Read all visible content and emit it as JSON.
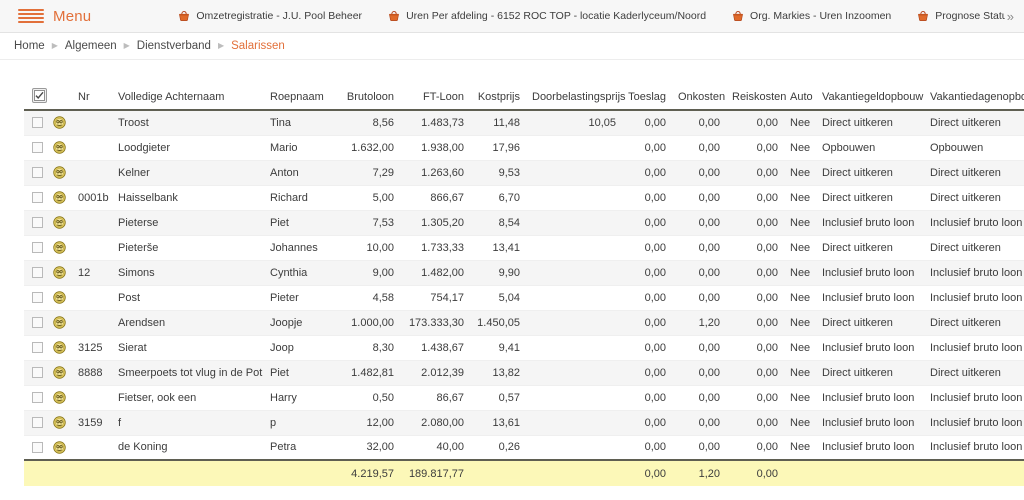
{
  "topbar": {
    "menu_label": "Menu",
    "menu_icon": "hamburger-icon",
    "overflow_icon": "double-chevron-right-icon",
    "tabs": [
      {
        "icon": "basket-icon",
        "label": "Omzetregistratie - J.U. Pool Beheer"
      },
      {
        "icon": "basket-icon",
        "label": "Uren Per afdeling - 6152 ROC TOP - locatie Kaderlyceum/Noord"
      },
      {
        "icon": "basket-icon",
        "label": "Org. Markies - Uren Inzoomen"
      },
      {
        "icon": "basket-icon",
        "label": "Prognose Status - J.U. Pool Beheer BV"
      }
    ]
  },
  "breadcrumb": {
    "separator": "▶",
    "items": [
      {
        "label": "Home",
        "current": false
      },
      {
        "label": "Algemeen",
        "current": false
      },
      {
        "label": "Dienstverband",
        "current": false
      },
      {
        "label": "Salarissen",
        "current": true
      }
    ]
  },
  "table": {
    "select_all_icon": "select-all-icon",
    "row_icon": "employee-coin-icon",
    "columns": [
      {
        "key": "check",
        "label": ""
      },
      {
        "key": "icon",
        "label": ""
      },
      {
        "key": "nr",
        "label": "Nr"
      },
      {
        "key": "ach",
        "label": "Volledige Achternaam"
      },
      {
        "key": "roep",
        "label": "Roepnaam"
      },
      {
        "key": "bruto",
        "label": "Brutoloon"
      },
      {
        "key": "ft",
        "label": "FT-Loon"
      },
      {
        "key": "kost",
        "label": "Kostprijs"
      },
      {
        "key": "door",
        "label": "Doorbelastingsprijs"
      },
      {
        "key": "toes",
        "label": "Toeslag"
      },
      {
        "key": "onk",
        "label": "Onkosten"
      },
      {
        "key": "reis",
        "label": "Reiskosten"
      },
      {
        "key": "auto",
        "label": "Auto"
      },
      {
        "key": "vgo",
        "label": "Vakantiegeldopbouw"
      },
      {
        "key": "vdo",
        "label": "Vakantiedagenopbouw"
      }
    ],
    "rows": [
      {
        "nr": "",
        "ach": "Troost",
        "roep": "Tina",
        "bruto": "8,56",
        "ft": "1.483,73",
        "kost": "11,48",
        "door": "10,05",
        "toes": "0,00",
        "onk": "0,00",
        "reis": "0,00",
        "auto": "Nee",
        "vgo": "Direct uitkeren",
        "vdo": "Direct uitkeren"
      },
      {
        "nr": "",
        "ach": "Loodgieter",
        "roep": "Mario",
        "bruto": "1.632,00",
        "ft": "1.938,00",
        "kost": "17,96",
        "door": "",
        "toes": "0,00",
        "onk": "0,00",
        "reis": "0,00",
        "auto": "Nee",
        "vgo": "Opbouwen",
        "vdo": "Opbouwen"
      },
      {
        "nr": "",
        "ach": "Kelner",
        "roep": "Anton",
        "bruto": "7,29",
        "ft": "1.263,60",
        "kost": "9,53",
        "door": "",
        "toes": "0,00",
        "onk": "0,00",
        "reis": "0,00",
        "auto": "Nee",
        "vgo": "Direct uitkeren",
        "vdo": "Direct uitkeren"
      },
      {
        "nr": "0001b",
        "ach": "Haisselbank",
        "roep": "Richard",
        "bruto": "5,00",
        "ft": "866,67",
        "kost": "6,70",
        "door": "",
        "toes": "0,00",
        "onk": "0,00",
        "reis": "0,00",
        "auto": "Nee",
        "vgo": "Direct uitkeren",
        "vdo": "Direct uitkeren"
      },
      {
        "nr": "",
        "ach": "Pieterse",
        "roep": "Piet",
        "bruto": "7,53",
        "ft": "1.305,20",
        "kost": "8,54",
        "door": "",
        "toes": "0,00",
        "onk": "0,00",
        "reis": "0,00",
        "auto": "Nee",
        "vgo": "Inclusief bruto loon",
        "vdo": "Inclusief bruto loon"
      },
      {
        "nr": "",
        "ach": "Pieterše",
        "roep": "Johannes",
        "bruto": "10,00",
        "ft": "1.733,33",
        "kost": "13,41",
        "door": "",
        "toes": "0,00",
        "onk": "0,00",
        "reis": "0,00",
        "auto": "Nee",
        "vgo": "Direct uitkeren",
        "vdo": "Direct uitkeren"
      },
      {
        "nr": "12",
        "ach": "Simons",
        "roep": "Cynthia",
        "bruto": "9,00",
        "ft": "1.482,00",
        "kost": "9,90",
        "door": "",
        "toes": "0,00",
        "onk": "0,00",
        "reis": "0,00",
        "auto": "Nee",
        "vgo": "Inclusief bruto loon",
        "vdo": "Inclusief bruto loon"
      },
      {
        "nr": "",
        "ach": "Post",
        "roep": "Pieter",
        "bruto": "4,58",
        "ft": "754,17",
        "kost": "5,04",
        "door": "",
        "toes": "0,00",
        "onk": "0,00",
        "reis": "0,00",
        "auto": "Nee",
        "vgo": "Inclusief bruto loon",
        "vdo": "Inclusief bruto loon"
      },
      {
        "nr": "",
        "ach": "Arendsen",
        "roep": "Joopje",
        "bruto": "1.000,00",
        "ft": "173.333,30",
        "kost": "1.450,05",
        "door": "",
        "toes": "0,00",
        "onk": "1,20",
        "reis": "0,00",
        "auto": "Nee",
        "vgo": "Direct uitkeren",
        "vdo": "Direct uitkeren"
      },
      {
        "nr": "3125",
        "ach": "Sierat",
        "roep": "Joop",
        "bruto": "8,30",
        "ft": "1.438,67",
        "kost": "9,41",
        "door": "",
        "toes": "0,00",
        "onk": "0,00",
        "reis": "0,00",
        "auto": "Nee",
        "vgo": "Inclusief bruto loon",
        "vdo": "Inclusief bruto loon"
      },
      {
        "nr": "8888",
        "ach": "Smeerpoets tot vlug in de Pot",
        "roep": "Piet",
        "bruto": "1.482,81",
        "ft": "2.012,39",
        "kost": "13,82",
        "door": "",
        "toes": "0,00",
        "onk": "0,00",
        "reis": "0,00",
        "auto": "Nee",
        "vgo": "Direct uitkeren",
        "vdo": "Direct uitkeren"
      },
      {
        "nr": "",
        "ach": "Fietser, ook een",
        "roep": "Harry",
        "bruto": "0,50",
        "ft": "86,67",
        "kost": "0,57",
        "door": "",
        "toes": "0,00",
        "onk": "0,00",
        "reis": "0,00",
        "auto": "Nee",
        "vgo": "Inclusief bruto loon",
        "vdo": "Inclusief bruto loon"
      },
      {
        "nr": "3159",
        "ach": "f",
        "roep": "p",
        "bruto": "12,00",
        "ft": "2.080,00",
        "kost": "13,61",
        "door": "",
        "toes": "0,00",
        "onk": "0,00",
        "reis": "0,00",
        "auto": "Nee",
        "vgo": "Inclusief bruto loon",
        "vdo": "Inclusief bruto loon"
      },
      {
        "nr": "",
        "ach": "de Koning",
        "roep": "Petra",
        "bruto": "32,00",
        "ft": "40,00",
        "kost": "0,26",
        "door": "",
        "toes": "0,00",
        "onk": "0,00",
        "reis": "0,00",
        "auto": "Nee",
        "vgo": "Inclusief bruto loon",
        "vdo": "Inclusief bruto loon"
      }
    ],
    "totals": {
      "nr": "",
      "ach": "",
      "roep": "",
      "bruto": "4.219,57",
      "ft": "189.817,77",
      "kost": "",
      "door": "",
      "toes": "0,00",
      "onk": "1,20",
      "reis": "0,00",
      "auto": "",
      "vgo": "",
      "vdo": ""
    }
  },
  "colors": {
    "accent": "#e2703a",
    "header_rule": "#5f5f52",
    "totals_bg": "#fcf8b8",
    "topbar_bg": "#f7f7f7",
    "row_alt_bg": "#f5f5f5"
  }
}
